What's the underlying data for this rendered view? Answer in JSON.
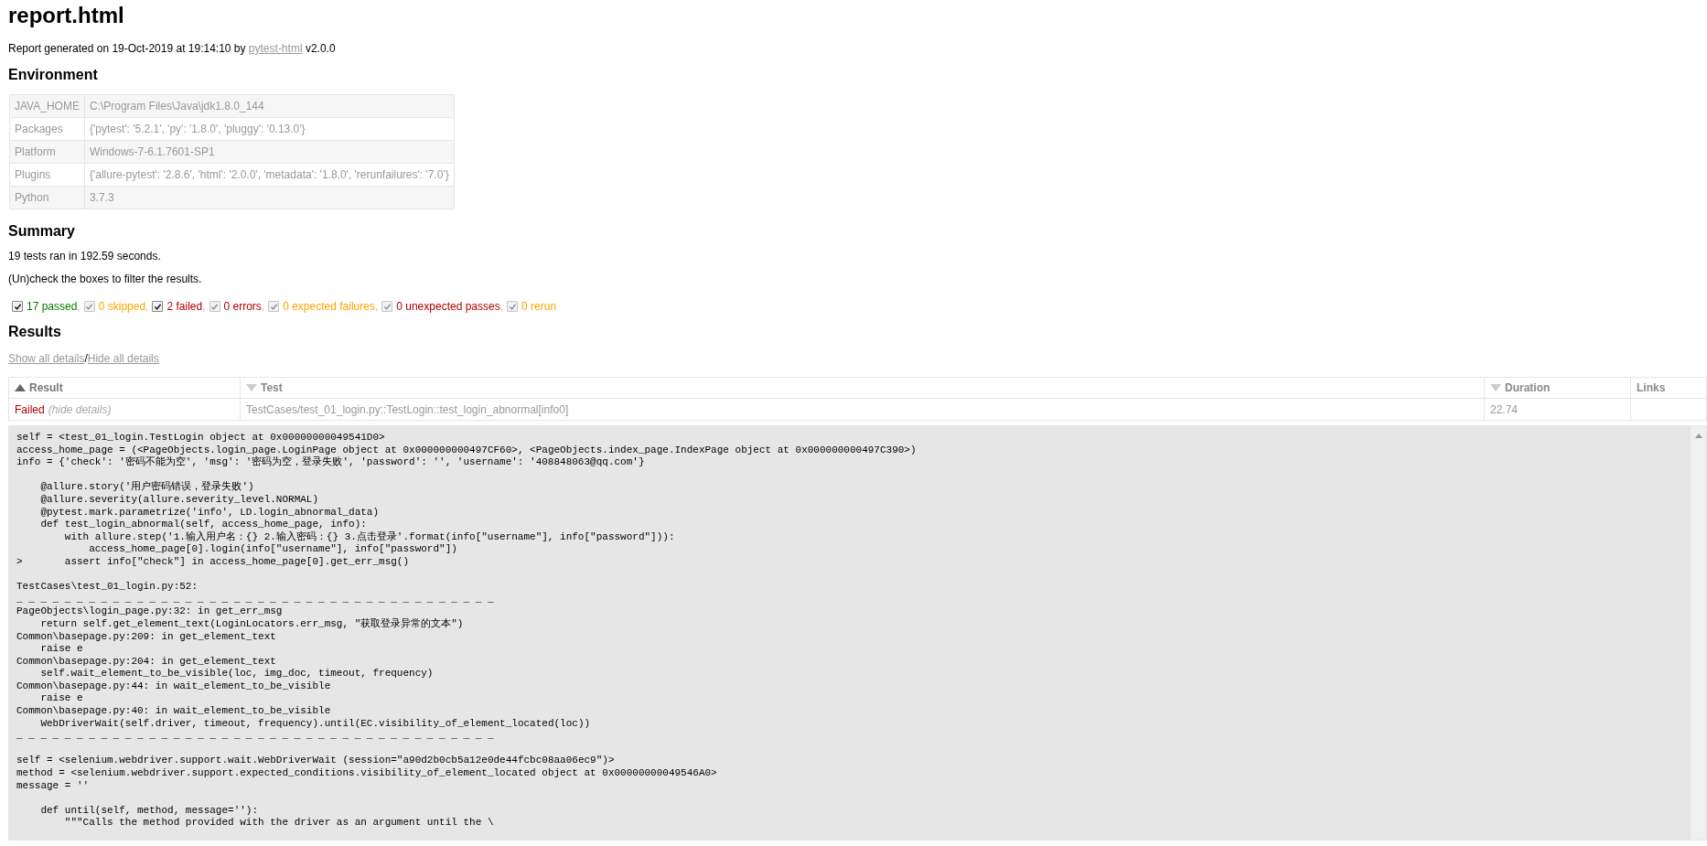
{
  "title": "report.html",
  "generated": {
    "prefix": "Report generated on 19-Oct-2019 at 19:14:10 by ",
    "link": "pytest-html",
    "suffix": " v2.0.0"
  },
  "environment": {
    "heading": "Environment",
    "rows": [
      {
        "key": "JAVA_HOME",
        "value": "C:\\Program Files\\Java\\jdk1.8.0_144"
      },
      {
        "key": "Packages",
        "value": "{'pytest': '5.2.1', 'py': '1.8.0', 'pluggy': '0.13.0'}"
      },
      {
        "key": "Platform",
        "value": "Windows-7-6.1.7601-SP1"
      },
      {
        "key": "Plugins",
        "value": "{'allure-pytest': '2.8.6', 'html': '2.0.0', 'metadata': '1.8.0', 'rerunfailures': '7.0'}"
      },
      {
        "key": "Python",
        "value": "3.7.3"
      }
    ]
  },
  "summary": {
    "heading": "Summary",
    "filter_separator": ",",
    "ran": "19 tests ran in 192.59 seconds.",
    "hint": "(Un)check the boxes to filter the results.",
    "filters": [
      {
        "label": "17 passed",
        "checked": true,
        "disabled": false,
        "color": "#008000"
      },
      {
        "label": "0 skipped",
        "checked": true,
        "disabled": true,
        "color": "#ffa500"
      },
      {
        "label": "2 failed",
        "checked": true,
        "disabled": false,
        "color": "#b00000"
      },
      {
        "label": "0 errors",
        "checked": true,
        "disabled": true,
        "color": "#b00000"
      },
      {
        "label": "0 expected failures",
        "checked": true,
        "disabled": true,
        "color": "#ffa500"
      },
      {
        "label": "0 unexpected passes",
        "checked": true,
        "disabled": true,
        "color": "#b00000"
      },
      {
        "label": "0 rerun",
        "checked": true,
        "disabled": true,
        "color": "#ffa500"
      }
    ]
  },
  "results": {
    "heading": "Results",
    "show_all": "Show all details",
    "separator": "/",
    "hide_all": "Hide all details",
    "columns": [
      {
        "label": "Result",
        "sortable": true,
        "sorted": true
      },
      {
        "label": "Test",
        "sortable": true,
        "sorted": false
      },
      {
        "label": "Duration",
        "sortable": true,
        "sorted": false
      },
      {
        "label": "Links",
        "sortable": false,
        "sorted": false
      }
    ],
    "rows": [
      {
        "result": "Failed",
        "toggle": "(hide details)",
        "test": "TestCases/test_01_login.py::TestLogin::test_login_abnormal[info0]",
        "duration": "22.74",
        "log": [
          "self = <test_01_login.TestLogin object at 0x00000000049541D0>",
          "access_home_page = (<PageObjects.login_page.LoginPage object at 0x000000000497CF60>, <PageObjects.index_page.IndexPage object at 0x000000000497C390>)",
          "info = {'check': '密码不能为空', 'msg': '密码为空，登录失败', 'password': '', 'username': '408848063@qq.com'}\n",
          "    @allure.story('用户密码错误，登录失败')",
          "    @allure.severity(allure.severity_level.NORMAL)",
          "    @pytest.mark.parametrize('info', LD.login_abnormal_data)",
          "    def test_login_abnormal(self, access_home_page, info):",
          "        with allure.step('1.输入用户名：{} 2.输入密码：{} 3.点击登录'.format(info[\"username\"], info[\"password\"])):",
          "            access_home_page[0].login(info[\"username\"], info[\"password\"])",
          ">       assert info[\"check\"] in access_home_page[0].get_err_msg()\n",
          "TestCases\\test_01_login.py:52:",
          "_ _ _ _ _ _ _ _ _ _ _ _ _ _ _ _ _ _ _ _ _ _ _ _ _ _ _ _ _ _ _ _ _ _ _ _ _ _ _ _",
          "PageObjects\\login_page.py:32: in get_err_msg",
          "    return self.get_element_text(LoginLocators.err_msg, \"获取登录异常的文本\")",
          "Common\\basepage.py:209: in get_element_text",
          "    raise e",
          "Common\\basepage.py:204: in get_element_text",
          "    self.wait_element_to_be_visible(loc, img_doc, timeout, frequency)",
          "Common\\basepage.py:44: in wait_element_to_be_visible",
          "    raise e",
          "Common\\basepage.py:40: in wait_element_to_be_visible",
          "    WebDriverWait(self.driver, timeout, frequency).until(EC.visibility_of_element_located(loc))",
          "_ _ _ _ _ _ _ _ _ _ _ _ _ _ _ _ _ _ _ _ _ _ _ _ _ _ _ _ _ _ _ _ _ _ _ _ _ _ _ _\n",
          "self = <selenium.webdriver.support.wait.WebDriverWait (session=\"a90d2b0cb5a12e0de44fcbc08aa06ec9\")>",
          "method = <selenium.webdriver.support.expected_conditions.visibility_of_element_located object at 0x00000000049546A0>",
          "message = ''\n",
          "    def until(self, method, message=''):",
          "        \"\"\"Calls the method provided with the driver as an argument until the \\"
        ]
      }
    ]
  }
}
